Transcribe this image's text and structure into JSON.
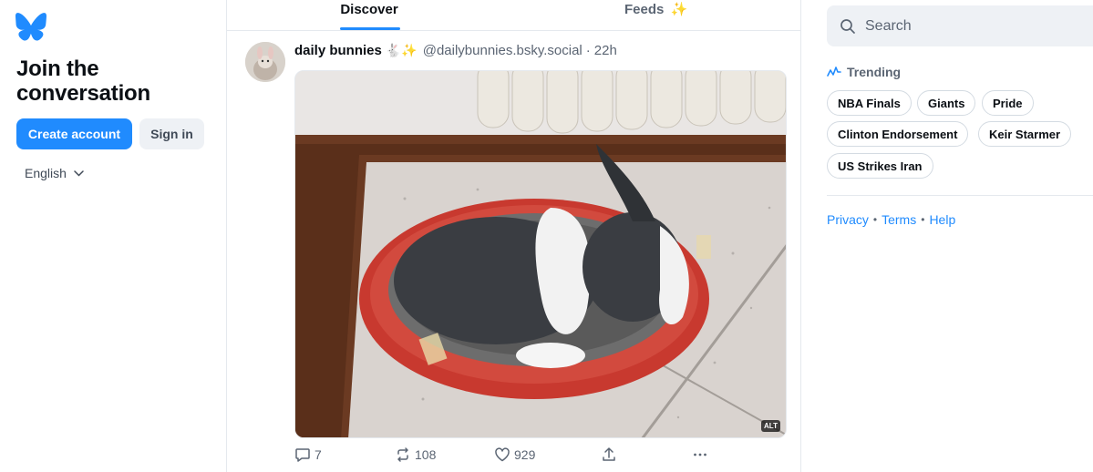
{
  "brand": {
    "accent": "#208bfe",
    "text_secondary": "#5b6573"
  },
  "left": {
    "logo_icon": "butterfly-logo-icon",
    "join_line1": "Join the",
    "join_line2": "conversation",
    "create_account": "Create account",
    "sign_in": "Sign in",
    "language": "English"
  },
  "tabs": [
    {
      "label": "Discover",
      "active": true
    },
    {
      "label": "Feeds",
      "icon": "sparkle-icon",
      "active": false
    }
  ],
  "post": {
    "author": "daily bunnies",
    "author_emojis": "🐇✨",
    "handle": "@dailybunnies.bsky.social",
    "separator": "·",
    "time": "22h",
    "image_alt_badge": "ALT",
    "reply_count": "7",
    "repost_count": "108",
    "like_count": "929"
  },
  "right": {
    "search_placeholder": "Search",
    "trending_label": "Trending",
    "trending": [
      "NBA Finals",
      "Giants",
      "Pride",
      "Clinton Endorsement",
      "Keir Starmer",
      "US Strikes Iran"
    ],
    "footer": {
      "privacy": "Privacy",
      "terms": "Terms",
      "help": "Help",
      "sep": "•"
    }
  }
}
